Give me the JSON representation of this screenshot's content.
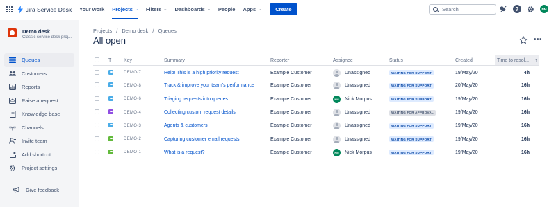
{
  "topnav": {
    "brand": "Jira Service Desk",
    "items": [
      {
        "label": "Your work",
        "active": false,
        "dropdown": false
      },
      {
        "label": "Projects",
        "active": true,
        "dropdown": true
      },
      {
        "label": "Filters",
        "active": false,
        "dropdown": true
      },
      {
        "label": "Dashboards",
        "active": false,
        "dropdown": true
      },
      {
        "label": "People",
        "active": false,
        "dropdown": false
      },
      {
        "label": "Apps",
        "active": false,
        "dropdown": true
      }
    ],
    "create_label": "Create",
    "search_placeholder": "Search",
    "user_initials": "NM"
  },
  "sidebar": {
    "project_name": "Demo desk",
    "project_type": "Classic service desk proj...",
    "items": [
      {
        "label": "Queues",
        "icon": "queues-icon",
        "active": true
      },
      {
        "label": "Customers",
        "icon": "customers-icon",
        "active": false
      },
      {
        "label": "Reports",
        "icon": "reports-icon",
        "active": false
      },
      {
        "label": "Raise a request",
        "icon": "raise-request-icon",
        "active": false
      },
      {
        "label": "Knowledge base",
        "icon": "knowledge-base-icon",
        "active": false
      },
      {
        "label": "Channels",
        "icon": "channels-icon",
        "active": false
      },
      {
        "label": "Invite team",
        "icon": "invite-team-icon",
        "active": false
      },
      {
        "label": "Add shortcut",
        "icon": "add-shortcut-icon",
        "active": false
      },
      {
        "label": "Project settings",
        "icon": "settings-icon",
        "active": false
      }
    ],
    "feedback_label": "Give feedback"
  },
  "main": {
    "breadcrumbs": [
      "Projects",
      "/",
      "Demo desk",
      "/",
      "Queues"
    ],
    "title": "All open",
    "columns": [
      "T",
      "Key",
      "Summary",
      "Reporter",
      "Assignee",
      "Status",
      "Created",
      "Time to resol..."
    ],
    "rows": [
      {
        "type": "service-request",
        "key": "DEMO-7",
        "summary": "Help! This is a high priority request",
        "reporter": "Example Customer",
        "assignee": "Unassigned",
        "assignee_initials": "",
        "status": "WAITING FOR SUPPORT",
        "created": "19/May/20",
        "time": "4h"
      },
      {
        "type": "service-request",
        "key": "DEMO-8",
        "summary": "Track & improve your team's performance",
        "reporter": "Example Customer",
        "assignee": "Unassigned",
        "assignee_initials": "",
        "status": "WAITING FOR SUPPORT",
        "created": "20/May/20",
        "time": "16h"
      },
      {
        "type": "service-request",
        "key": "DEMO-6",
        "summary": "Triaging requests into queues",
        "reporter": "Example Customer",
        "assignee": "Nick Morpus",
        "assignee_initials": "NM",
        "status": "WAITING FOR SUPPORT",
        "created": "19/May/20",
        "time": "16h"
      },
      {
        "type": "approval",
        "key": "DEMO-4",
        "summary": "Collecting custom request details",
        "reporter": "Example Customer",
        "assignee": "Unassigned",
        "assignee_initials": "",
        "status": "WAITING FOR APPROVAL",
        "created": "19/May/20",
        "time": "16h"
      },
      {
        "type": "service-request",
        "key": "DEMO-3",
        "summary": "Agents & customers",
        "reporter": "Example Customer",
        "assignee": "Unassigned",
        "assignee_initials": "",
        "status": "WAITING FOR SUPPORT",
        "created": "19/May/20",
        "time": "16h"
      },
      {
        "type": "task",
        "key": "DEMO-2",
        "summary": "Capturing customer email requests",
        "reporter": "Example Customer",
        "assignee": "Unassigned",
        "assignee_initials": "",
        "status": "WAITING FOR SUPPORT",
        "created": "19/May/20",
        "time": "16h"
      },
      {
        "type": "task",
        "key": "DEMO-1",
        "summary": "What is a request?",
        "reporter": "Example Customer",
        "assignee": "Nick Morpus",
        "assignee_initials": "NM",
        "status": "WAITING FOR SUPPORT",
        "created": "19/May/20",
        "time": "16h"
      }
    ]
  },
  "colors": {
    "brand_blue": "#0052CC",
    "status_support_bg": "#DEEBFF",
    "status_support_fg": "#0747A6",
    "status_approval_bg": "#DFE1E6",
    "status_approval_fg": "#42526E",
    "type_service_request": "#4BADE8",
    "type_approval": "#904EE2",
    "type_task": "#63BA3C"
  }
}
